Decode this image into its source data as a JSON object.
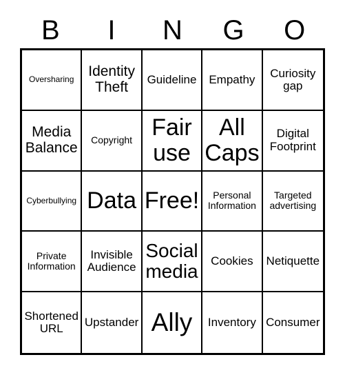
{
  "card": {
    "type": "bingo-card",
    "grid_size": "5x5",
    "header_letters": [
      "B",
      "I",
      "N",
      "G",
      "O"
    ],
    "colors": {
      "background": "#ffffff",
      "text": "#000000",
      "grid_line": "#000000"
    },
    "columns": [
      {
        "letter": "B",
        "cells": [
          {
            "label": "Oversharing",
            "size": "xs"
          },
          {
            "label": "Media Balance",
            "size": "lg"
          },
          {
            "label": "Cyberbullying",
            "size": "xs"
          },
          {
            "label": "Private Information",
            "size": "sm"
          },
          {
            "label": "Shortened URL",
            "size": "md"
          }
        ]
      },
      {
        "letter": "I",
        "cells": [
          {
            "label": "Identity Theft",
            "size": "lg"
          },
          {
            "label": "Copyright",
            "size": "sm"
          },
          {
            "label": "Data",
            "size": "xxl"
          },
          {
            "label": "Invisible Audience",
            "size": "md"
          },
          {
            "label": "Upstander",
            "size": "md"
          }
        ]
      },
      {
        "letter": "N",
        "cells": [
          {
            "label": "Guideline",
            "size": "md"
          },
          {
            "label": "Fair use",
            "size": "xxl"
          },
          {
            "label": "Free!",
            "size": "xxl"
          },
          {
            "label": "Social media",
            "size": "xl"
          },
          {
            "label": "Ally",
            "size": "xxxl"
          }
        ]
      },
      {
        "letter": "G",
        "cells": [
          {
            "label": "Empathy",
            "size": "md"
          },
          {
            "label": "All Caps",
            "size": "xxl"
          },
          {
            "label": "Personal Information",
            "size": "sm"
          },
          {
            "label": "Cookies",
            "size": "md"
          },
          {
            "label": "Inventory",
            "size": "md"
          }
        ]
      },
      {
        "letter": "O",
        "cells": [
          {
            "label": "Curiosity gap",
            "size": "md"
          },
          {
            "label": "Digital Footprint",
            "size": "md"
          },
          {
            "label": "Targeted advertising",
            "size": "sm"
          },
          {
            "label": "Netiquette",
            "size": "md"
          },
          {
            "label": "Consumer",
            "size": "md"
          }
        ]
      }
    ],
    "rows": [
      [
        "Oversharing",
        "Identity Theft",
        "Guideline",
        "Empathy",
        "Curiosity gap"
      ],
      [
        "Media Balance",
        "Copyright",
        "Fair use",
        "All Caps",
        "Digital Footprint"
      ],
      [
        "Cyberbullying",
        "Data",
        "Free!",
        "Personal Information",
        "Targeted advertising"
      ],
      [
        "Private Information",
        "Invisible Audience",
        "Social media",
        "Cookies",
        "Netiquette"
      ],
      [
        "Shortened URL",
        "Upstander",
        "Ally",
        "Inventory",
        "Consumer"
      ]
    ]
  }
}
